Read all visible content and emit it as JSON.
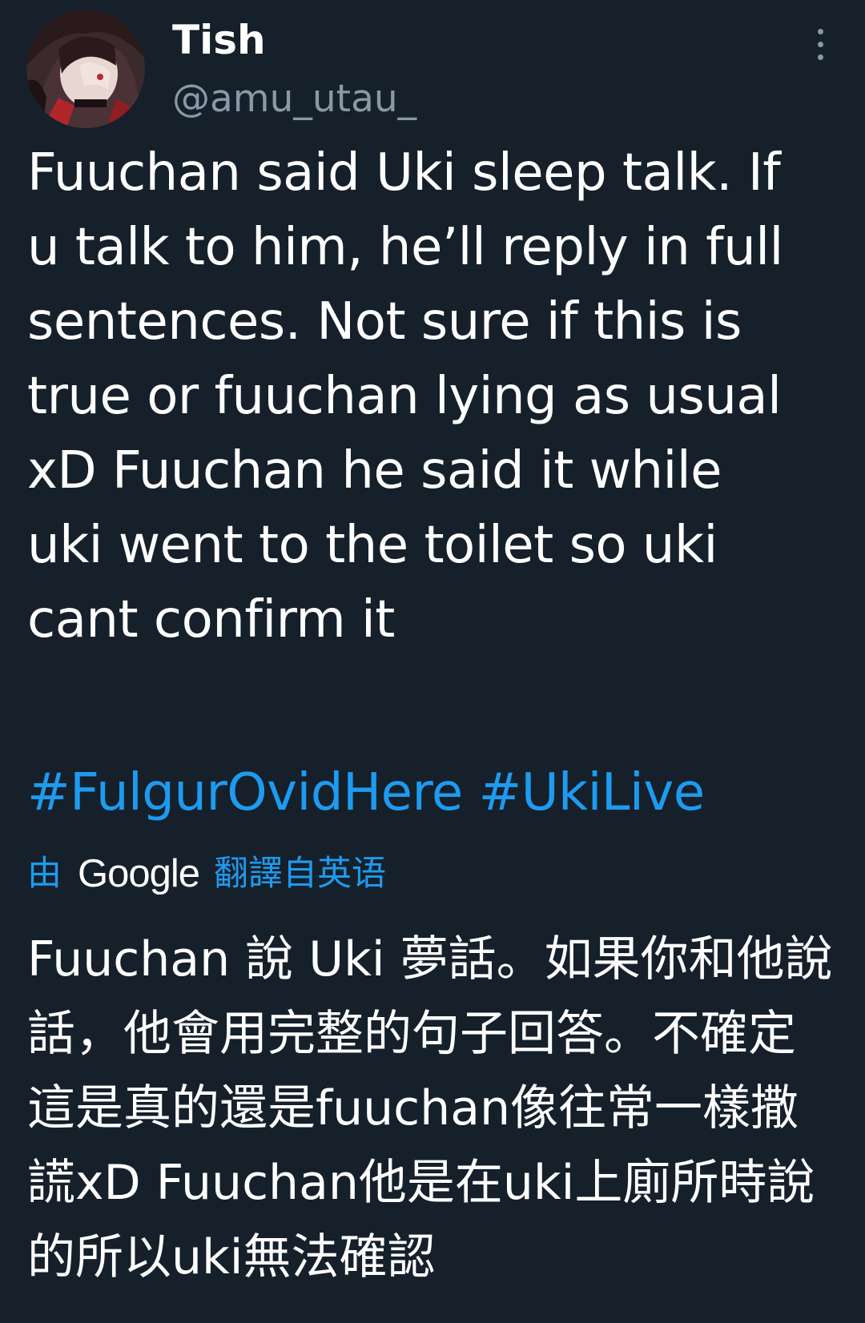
{
  "user": {
    "display_name": "Tish",
    "handle": "@amu_utau_"
  },
  "tweet": {
    "text_lines": [
      "Fuuchan said Uki sleep talk. If",
      "u talk to him, he’ll reply in full",
      "sentences. Not sure if this is",
      "true or fuuchan lying as usual",
      "xD Fuuchan he said it while",
      "uki went to the toilet so uki",
      "cant confirm it"
    ],
    "hashtags": [
      "#FulgurOvidHere",
      "#UkiLive"
    ]
  },
  "translation": {
    "prefix": "由",
    "provider": "Google",
    "suffix": "翻譯自英语",
    "text_lines": [
      "Fuuchan 說 Uki 夢話。如果你和他說",
      "話，他會用完整的句子回答。不確定",
      "這是真的還是fuuchan像往常一樣撒",
      "謊xD Fuuchan他是在uki上廁所時說",
      "的所以uki無法確認"
    ]
  },
  "icons": {
    "avatar": "avatar-image",
    "more": "more-vertical-icon"
  },
  "colors": {
    "background": "#15202b",
    "text": "#ffffff",
    "secondary": "#8b98a5",
    "accent": "#1d9bf0"
  }
}
